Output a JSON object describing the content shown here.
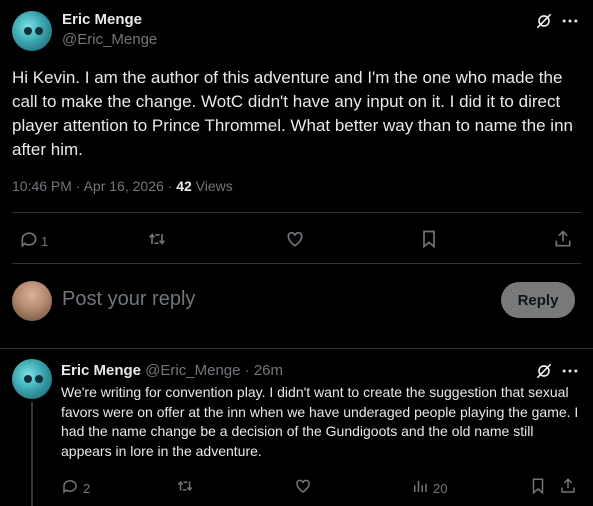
{
  "main_tweet": {
    "author_name": "Eric Menge",
    "author_handle": "@Eric_Menge",
    "text": "Hi Kevin. I am the author of this adventure and I'm the one who made the call to make the change. WotC didn't have any input on it. I did it to direct player attention to Prince Thrommel. What better way than to name the inn after him.",
    "timestamp": "10:46 PM · Apr 16, 2026 · ",
    "views_count": "42",
    "views_label": " Views",
    "reply_count": "1"
  },
  "composer": {
    "placeholder": "Post your reply",
    "reply_label": "Reply"
  },
  "reply_tweet": {
    "author_name": "Eric Menge",
    "author_handle": "@Eric_Menge",
    "time": " · 26m",
    "text": "We're writing for convention play. I didn't want to create the suggestion that sexual favors were on offer at the inn when we have underaged people playing the game. I had the name change be a decision of the Gundigoots and the old name still appears in lore in the adventure.",
    "reply_count": "2",
    "views_count": "20"
  },
  "icons": {
    "grok": "grok-icon",
    "more": "more-icon",
    "reply": "reply-icon",
    "retweet": "retweet-icon",
    "like": "heart-icon",
    "bookmark": "bookmark-icon",
    "share": "share-icon",
    "views": "views-icon"
  }
}
